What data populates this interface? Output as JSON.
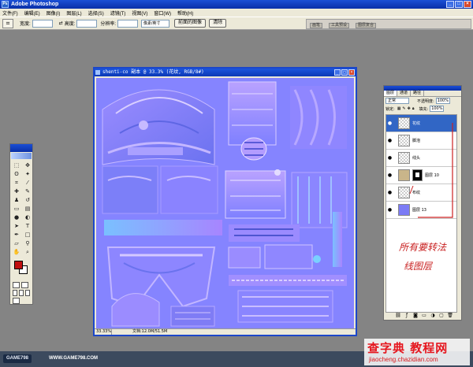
{
  "app": {
    "title": "Adobe Photoshop"
  },
  "menubar": [
    "文件(F)",
    "编辑(E)",
    "图像(I)",
    "图层(L)",
    "选择(S)",
    "滤镜(T)",
    "视图(V)",
    "窗口(W)",
    "帮助(H)"
  ],
  "options": {
    "width_label": "宽度:",
    "height_label": "高度:",
    "resolution_label": "分辨率:",
    "unit": "像素/英寸",
    "front_image_button": "前面的图像",
    "clear_button": "清除",
    "well_tabs": [
      "画笔",
      "工具预设",
      "图层复合"
    ]
  },
  "document": {
    "title": "shenti-co 副本 @ 33.3% (花纹, RGB/8#)",
    "zoom": "33.33%",
    "doc_info": "文档:12.0M/51.5M"
  },
  "layers_panel": {
    "tabs": [
      "图层",
      "通道",
      "路径"
    ],
    "blend_mode": "正常",
    "opacity_label": "不透明度:",
    "opacity": "100%",
    "lock_label": "锁定:",
    "fill_label": "填充:",
    "fill": "100%",
    "layers": [
      {
        "name": "花纹",
        "thumb": "checker",
        "selected": true
      },
      {
        "name": "脚泡",
        "thumb": "checker",
        "selected": false
      },
      {
        "name": "线头",
        "thumb": "checker",
        "selected": false
      },
      {
        "name": "图层 10",
        "thumb": "tan",
        "mask": true,
        "selected": false
      },
      {
        "name": "布纹",
        "thumb": "checker",
        "selected": false
      },
      {
        "name": "图层 13",
        "thumb": "blue",
        "selected": false
      }
    ],
    "annotation_line1": "所有要转法",
    "annotation_line2": "线图层"
  },
  "taskbar": {
    "logo": "GAME798",
    "url": "WWW.GAME798.COM"
  },
  "watermark": {
    "main": "查字典 教程网",
    "sub": "jiaocheng.chazidian.com"
  },
  "colors": {
    "foreground": "#c00f10",
    "background": "#ffffff",
    "normal_map": "#8080ff",
    "title_blue": "#0a2fa8"
  }
}
